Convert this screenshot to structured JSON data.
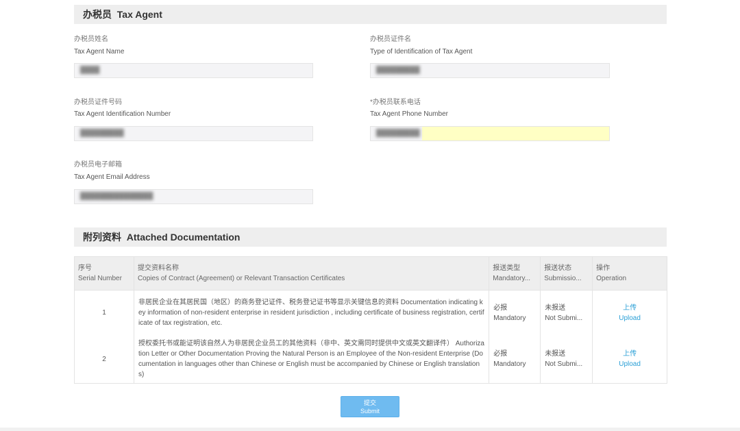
{
  "tax_agent_section": {
    "title_cn": "办税员",
    "title_en": "Tax Agent",
    "fields": {
      "name": {
        "label_cn": "办税员姓名",
        "label_en": "Tax Agent Name",
        "value": "████"
      },
      "id_type": {
        "label_cn": "办税员证件名",
        "label_en": "Type of Identification of Tax Agent",
        "value": "█████████"
      },
      "id_number": {
        "label_cn": "办税员证件号码",
        "label_en": "Tax Agent Identification Number",
        "value": "█████████"
      },
      "phone": {
        "label_cn": "*办税员联系电话",
        "label_en": "Tax Agent Phone Number",
        "value": "█████████"
      },
      "email": {
        "label_cn": "办税员电子邮箱",
        "label_en": "Tax Agent Email Address",
        "value": "███████████████"
      }
    }
  },
  "docs_section": {
    "title_cn": "附列资料",
    "title_en": "Attached Documentation",
    "columns": [
      {
        "cn": "序号",
        "en": "Serial Number"
      },
      {
        "cn": "提交资料名称",
        "en": "Copies of Contract (Agreement) or Relevant Transaction Certificates"
      },
      {
        "cn": "报送类型",
        "en": "Mandatory..."
      },
      {
        "cn": "报送状态",
        "en": "Submissio..."
      },
      {
        "cn": "操作",
        "en": "Operation"
      }
    ],
    "rows": [
      {
        "serial": "1",
        "description": "非居民企业在其居民国（地区）的商务登记证件、税务登记证书等显示关键信息的资料 Documentation indicating key information of non-resident enterprise in resident jurisdiction , including certificate of business registration, certificate of tax registration, etc.",
        "type_cn": "必报",
        "type_en": "Mandatory",
        "status_cn": "未报送",
        "status_en": "Not Submi...",
        "op_cn": "上传",
        "op_en": "Upload"
      },
      {
        "serial": "2",
        "description": "授权委托书或能证明该自然人为非居民企业员工的其他资料（非中、英文需同时提供中文或英文翻译件） Authorization Letter or Other Documentation Proving the Natural Person is an Employee of the Non-resident Enterprise (Documentation in languages other than Chinese or English must be accompanied by Chinese or English translations)",
        "type_cn": "必报",
        "type_en": "Mandatory",
        "status_cn": "未报送",
        "status_en": "Not Submi...",
        "op_cn": "上传",
        "op_en": "Upload"
      }
    ]
  },
  "submit": {
    "label_cn": "提交",
    "label_en": "Submit"
  }
}
